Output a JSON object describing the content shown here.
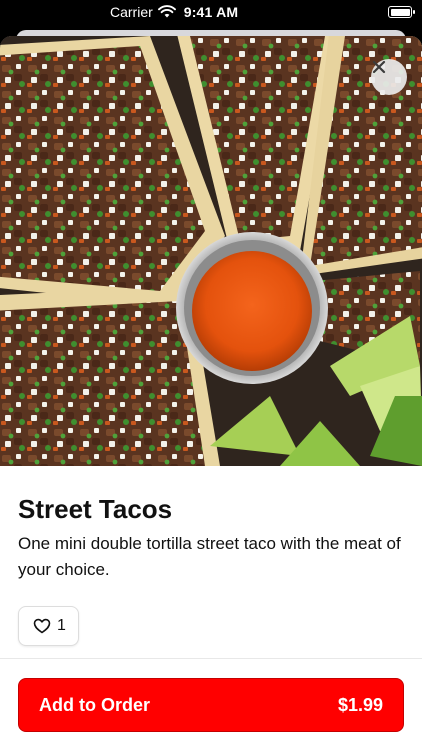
{
  "status_bar": {
    "carrier": "Carrier",
    "time": "9:41 AM",
    "wifi_icon": "wifi-icon",
    "battery_icon": "battery-icon"
  },
  "item": {
    "title": "Street Tacos",
    "description": "One mini double tortilla street taco with the meat of your choice.",
    "image_icon": "tacos-photo",
    "likes": "1"
  },
  "actions": {
    "close_icon": "close-icon",
    "like_icon": "heart-icon",
    "add_label": "Add to Order",
    "price": "$1.99"
  },
  "colors": {
    "accent": "#ff0000",
    "text": "#111111"
  }
}
